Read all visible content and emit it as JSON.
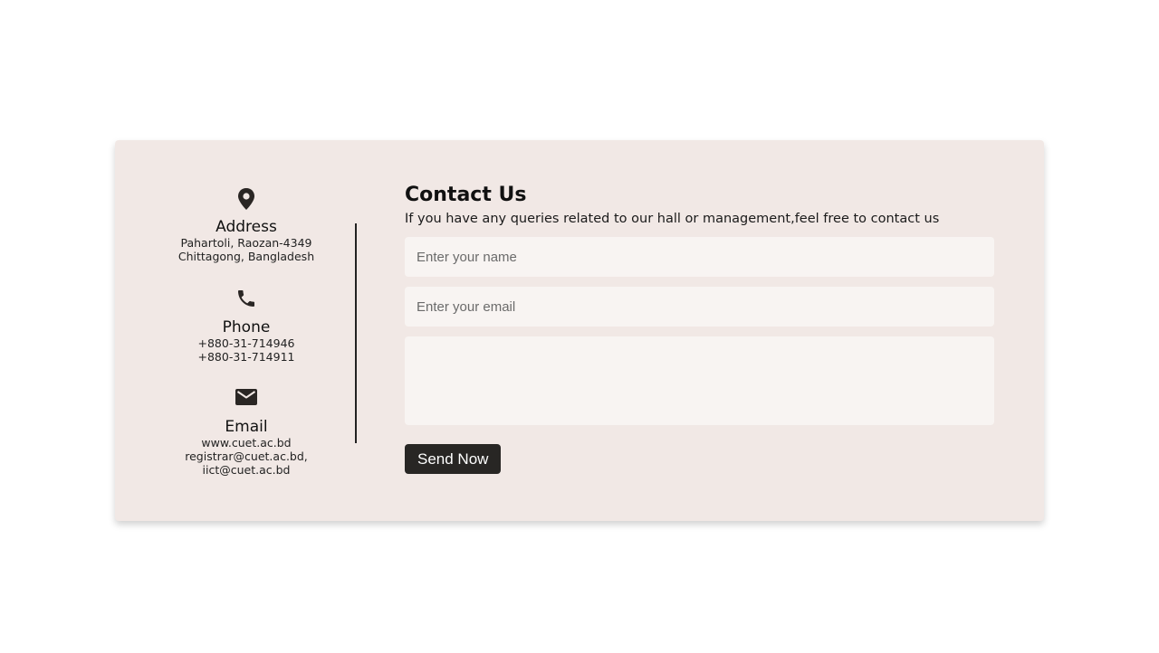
{
  "contact_info": {
    "address": {
      "icon": "map-pin-icon",
      "heading": "Address",
      "lines": [
        "Pahartoli, Raozan-4349",
        "Chittagong, Bangladesh"
      ]
    },
    "phone": {
      "icon": "phone-icon",
      "heading": "Phone",
      "lines": [
        "+880-31-714946",
        "+880-31-714911"
      ]
    },
    "email": {
      "icon": "envelope-icon",
      "heading": "Email",
      "lines": [
        "www.cuet.ac.bd",
        "registrar@cuet.ac.bd,",
        "iict@cuet.ac.bd"
      ]
    }
  },
  "form": {
    "title": "Contact Us",
    "subtitle": "If you have any queries related to our hall or management,feel free to contact us",
    "name_placeholder": "Enter your name",
    "email_placeholder": "Enter your email",
    "message_placeholder": "",
    "submit_label": "Send Now"
  },
  "colors": {
    "card_background": "#f1e8e5",
    "field_background": "#f8f4f2",
    "button_background": "#282624",
    "text": "#1d1d1d"
  }
}
